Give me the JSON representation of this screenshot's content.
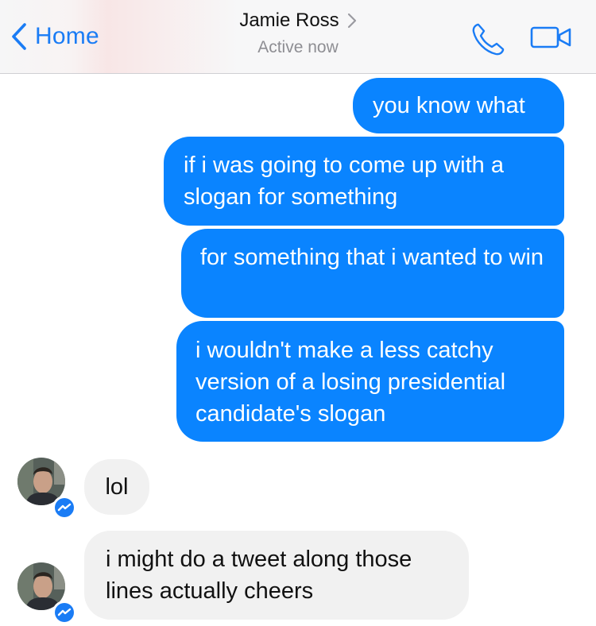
{
  "nav": {
    "back_label": "Home",
    "contact_name": "Jamie Ross",
    "status": "Active now",
    "call_icon": "phone-icon",
    "video_icon": "video-camera-icon"
  },
  "messages": [
    {
      "direction": "outgoing",
      "text": "you know what"
    },
    {
      "direction": "outgoing",
      "text": "if i was going to come up with a slogan for something"
    },
    {
      "direction": "outgoing",
      "text": "for something that i wanted to win"
    },
    {
      "direction": "outgoing",
      "text": "i wouldn't make a less catchy version of a losing presidential candidate's slogan"
    },
    {
      "direction": "incoming",
      "text": "lol"
    },
    {
      "direction": "incoming",
      "text": "i might do a tweet along those lines actually cheers"
    }
  ],
  "colors": {
    "accent": "#1a7cf5",
    "outgoing_bubble": "#0a84ff",
    "incoming_bubble": "#f1f1f1"
  }
}
